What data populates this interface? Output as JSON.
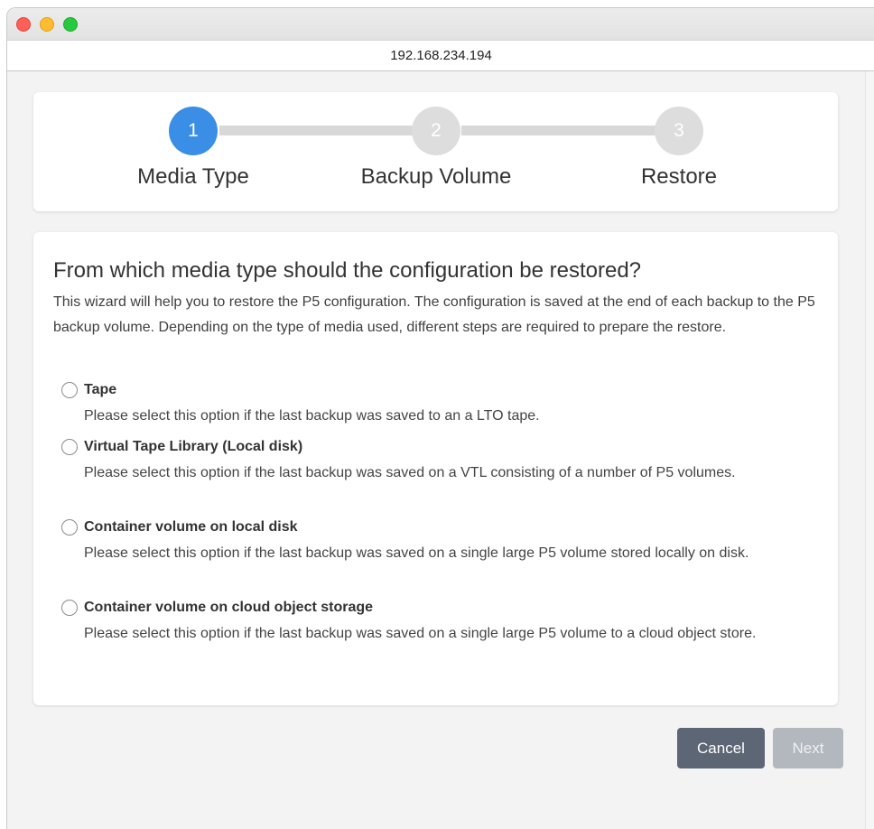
{
  "browser": {
    "address": "192.168.234.194"
  },
  "wizard": {
    "steps": [
      {
        "number": "1",
        "label": "Media Type",
        "active": true
      },
      {
        "number": "2",
        "label": "Backup Volume",
        "active": false
      },
      {
        "number": "3",
        "label": "Restore",
        "active": false
      }
    ],
    "accent_color": "#3a8ee6"
  },
  "main": {
    "heading": "From which media type should the configuration be restored?",
    "intro": "This wizard will help you to restore the P5 configuration. The configuration is saved at the end of each backup to the P5 backup volume. Depending on the type of media used, different steps are required to prepare the restore.",
    "options": [
      {
        "title": "Tape",
        "description": "Please select this option if the last backup was saved to an a LTO tape."
      },
      {
        "title": "Virtual Tape Library (Local disk)",
        "description": "Please select this option if the last backup was saved on a VTL consisting of a number of P5 volumes."
      },
      {
        "title": "Container volume on local disk",
        "description": "Please select this option if the last backup was saved on a single large P5 volume stored locally on disk."
      },
      {
        "title": "Container volume on cloud object storage",
        "description": "Please select this option if the last backup was saved on a single large P5 volume to a cloud object store."
      }
    ]
  },
  "footer": {
    "cancel_label": "Cancel",
    "next_label": "Next"
  }
}
